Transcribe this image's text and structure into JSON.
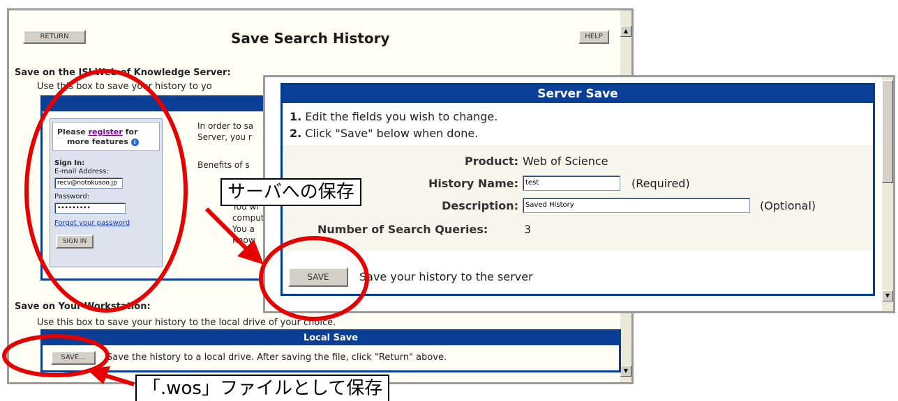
{
  "back_window": {
    "return_button": "RETURN",
    "title": "Save Search History",
    "help_button": "HELP",
    "server_heading": "Save on the ISI Web of Knowledge Server:",
    "server_intro": "Use this box to save your history to yo",
    "login_panel": {
      "prompt_before": "Please ",
      "register_link": "register",
      "prompt_after": " for",
      "prompt_line2": "more features",
      "info_glyph": "i",
      "sign_in_label": "Sign In:",
      "email_label": "E-mail Address:",
      "email_value": "recv@notokusoo.jp",
      "password_label": "Password:",
      "password_value": "•••••••••",
      "forgot_link": "Forgot your password",
      "sign_in_button": "SIGN IN"
    },
    "order_text_1": "In order to sa",
    "order_text_2": "Server, you r",
    "benefits_text": "Benefits of s",
    "bullet_1a": "You wi",
    "bullet_1b": "comput",
    "bullet_2a": "You a",
    "bullet_2b": "Know",
    "workstation_heading": "Save on Your Workstation:",
    "workstation_intro": "Use this box to save your history to the local drive of your choice.",
    "local_save_header": "Local Save",
    "local_save_button": "SAVE...",
    "local_save_text": "Save the history to a local drive. After saving the file, click \"Return\" above."
  },
  "front_window": {
    "header": "Server Save",
    "step1_num": "1.",
    "step1_text": " Edit the fields you wish to change.",
    "step2_num": "2.",
    "step2_text": " Click \"Save\" below when done.",
    "product_label": "Product:",
    "product_value": "Web of Science",
    "history_name_label": "History Name:",
    "history_name_value": "test",
    "history_name_hint": "(Required)",
    "description_label": "Description:",
    "description_value": "Saved History",
    "description_hint": "(Optional)",
    "queries_label": "Number of Search Queries:",
    "queries_value": "3",
    "save_button": "SAVE",
    "save_text": "Save your history to the server"
  },
  "annotations": {
    "server_callout": "サーバへの保存",
    "wos_callout": "「.wos」ファイルとして保存"
  },
  "colors": {
    "header_blue": "#0a3f95",
    "annotation_red": "#e60000"
  }
}
